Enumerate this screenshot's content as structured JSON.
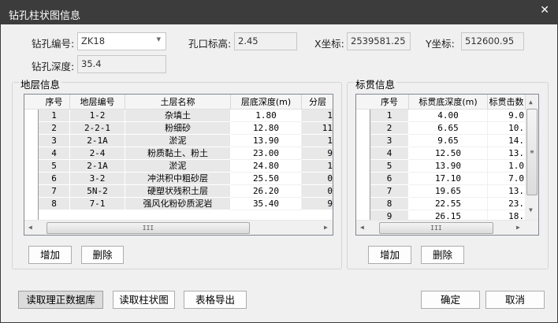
{
  "window": {
    "title": "钻孔柱状图信息",
    "close": "✕"
  },
  "form": {
    "hole_id_label": "钻孔编号:",
    "hole_id": "ZK18",
    "elevation_label": "孔口标高:",
    "elevation": "2.45",
    "x_label": "X坐标:",
    "x": "2539581.25",
    "y_label": "Y坐标:",
    "y": "512600.95",
    "depth_label": "钻孔深度:",
    "depth": "35.4"
  },
  "strata": {
    "title": "地层信息",
    "columns": [
      "序号",
      "地层编号",
      "土层名称",
      "层底深度(m)",
      "分层"
    ],
    "rows": [
      [
        "1",
        "1-2",
        "杂填土",
        "1.80",
        "1"
      ],
      [
        "2",
        "2-2-1",
        "粉细砂",
        "12.80",
        "11"
      ],
      [
        "3",
        "2-1A",
        "淤泥",
        "13.90",
        "1"
      ],
      [
        "4",
        "2-4",
        "粉质黏土、粉土",
        "23.00",
        "9"
      ],
      [
        "5",
        "2-1A",
        "淤泥",
        "24.80",
        "1"
      ],
      [
        "6",
        "3-2",
        "冲洪积中粗砂层",
        "25.50",
        "0"
      ],
      [
        "7",
        "5N-2",
        "硬塑状残积土层",
        "26.20",
        "0"
      ],
      [
        "8",
        "7-1",
        "强风化粉砂质泥岩",
        "35.40",
        "9"
      ]
    ],
    "add": "增加",
    "delete": "删除"
  },
  "spt": {
    "title": "标贯信息",
    "columns": [
      "序号",
      "标贯底深度(m)",
      "标贯击数"
    ],
    "rows": [
      [
        "1",
        "4.00",
        "9.0"
      ],
      [
        "2",
        "6.65",
        "10."
      ],
      [
        "3",
        "9.65",
        "14."
      ],
      [
        "4",
        "12.50",
        "13."
      ],
      [
        "5",
        "13.90",
        "1.0"
      ],
      [
        "6",
        "17.10",
        "7.0"
      ],
      [
        "7",
        "19.65",
        "13."
      ],
      [
        "8",
        "22.55",
        "23."
      ],
      [
        "9",
        "26.15",
        "18."
      ]
    ],
    "add": "增加",
    "delete": "删除"
  },
  "footer": {
    "read_db": "读取理正数据库",
    "read_chart": "读取柱状图",
    "export": "表格导出",
    "ok": "确定",
    "cancel": "取消"
  }
}
